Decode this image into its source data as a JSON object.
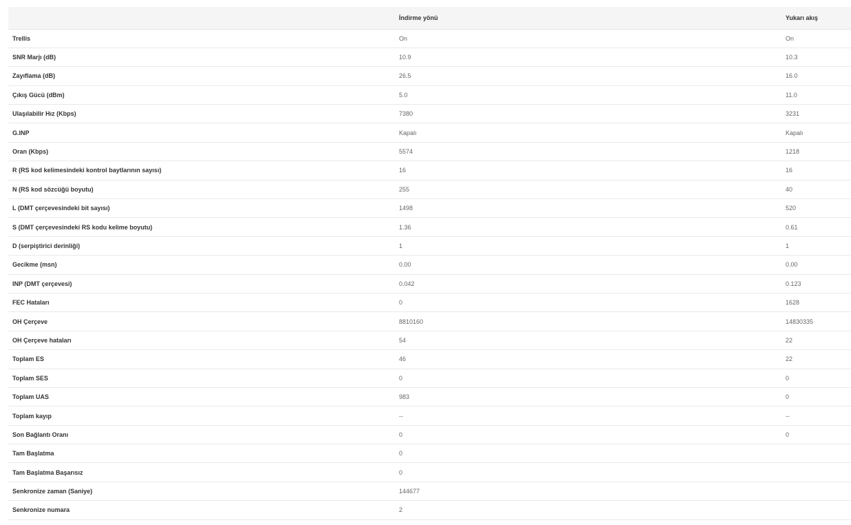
{
  "header": {
    "col_label": "",
    "col_down": "İndirme yönü",
    "col_up": "Yukarı akış"
  },
  "rows": [
    {
      "label": "Trellis",
      "down": "On",
      "up": "On"
    },
    {
      "label": "SNR Marjı (dB)",
      "down": "10.9",
      "up": "10.3"
    },
    {
      "label": "Zayıflama (dB)",
      "down": "26.5",
      "up": "16.0"
    },
    {
      "label": "Çıkış Gücü (dBm)",
      "down": "5.0",
      "up": "11.0"
    },
    {
      "label": "Ulaşılabilir Hız (Kbps)",
      "down": "7380",
      "up": "3231"
    },
    {
      "label": "G.INP",
      "down": "Kapalı",
      "up": "Kapalı"
    },
    {
      "label": "Oran (Kbps)",
      "down": "5574",
      "up": "1218"
    },
    {
      "label": "R (RS kod kelimesindeki kontrol baytlarının sayısı)",
      "down": "16",
      "up": "16"
    },
    {
      "label": "N (RS kod sözcüğü boyutu)",
      "down": "255",
      "up": "40"
    },
    {
      "label": "L (DMT çerçevesindeki bit sayısı)",
      "down": "1498",
      "up": "520"
    },
    {
      "label": "S (DMT çerçevesindeki RS kodu kelime boyutu)",
      "down": "1.36",
      "up": "0.61"
    },
    {
      "label": "D (serpiştirici derinliği)",
      "down": "1",
      "up": "1"
    },
    {
      "label": "Gecikme (msn)",
      "down": "0.00",
      "up": "0.00"
    },
    {
      "label": "INP (DMT çerçevesi)",
      "down": "0.042",
      "up": "0.123"
    },
    {
      "label": "FEC Hataları",
      "down": "0",
      "up": "1628"
    },
    {
      "label": "OH Çerçeve",
      "down": "8810160",
      "up": "14830335"
    },
    {
      "label": "OH Çerçeve hataları",
      "down": "54",
      "up": "22"
    },
    {
      "label": "Toplam ES",
      "down": "46",
      "up": "22"
    },
    {
      "label": "Toplam SES",
      "down": "0",
      "up": "0"
    },
    {
      "label": "Toplam UAS",
      "down": "983",
      "up": "0"
    },
    {
      "label": "Toplam kayıp",
      "down": "--",
      "up": "--"
    },
    {
      "label": "Son Bağlantı Oranı",
      "down": "0",
      "up": "0"
    },
    {
      "label": "Tam Başlatma",
      "down": "0",
      "up": ""
    },
    {
      "label": "Tam Başlatma Başarısız",
      "down": "0",
      "up": ""
    },
    {
      "label": "Senkronize zaman (Saniye)",
      "down": "144677",
      "up": ""
    },
    {
      "label": "Senkronize numara",
      "down": "2",
      "up": ""
    }
  ]
}
